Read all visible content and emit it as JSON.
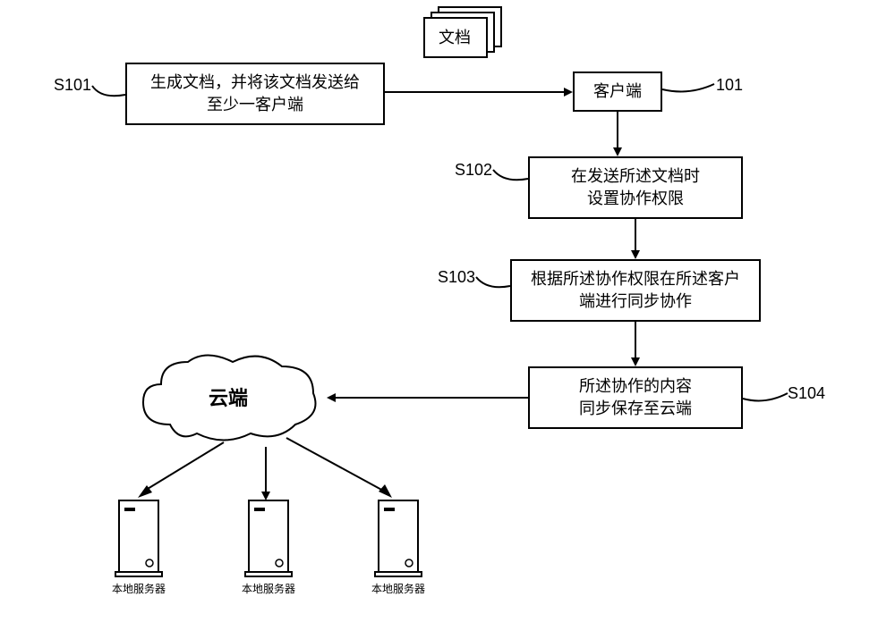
{
  "nodes": {
    "doc_icon": "文档",
    "s101": "生成文档，并将该文档发送给\n至少一客户端",
    "client": "客户端",
    "s102": "在发送所述文档时\n设置协作权限",
    "s103": "根据所述协作权限在所述客户\n端进行同步协作",
    "s104": "所述协作的内容\n同步保存至云端",
    "cloud": "云端"
  },
  "labels": {
    "s101": "S101",
    "s102": "S102",
    "s103": "S103",
    "s104": "S104",
    "id101": "101",
    "server": "本地服务器"
  }
}
